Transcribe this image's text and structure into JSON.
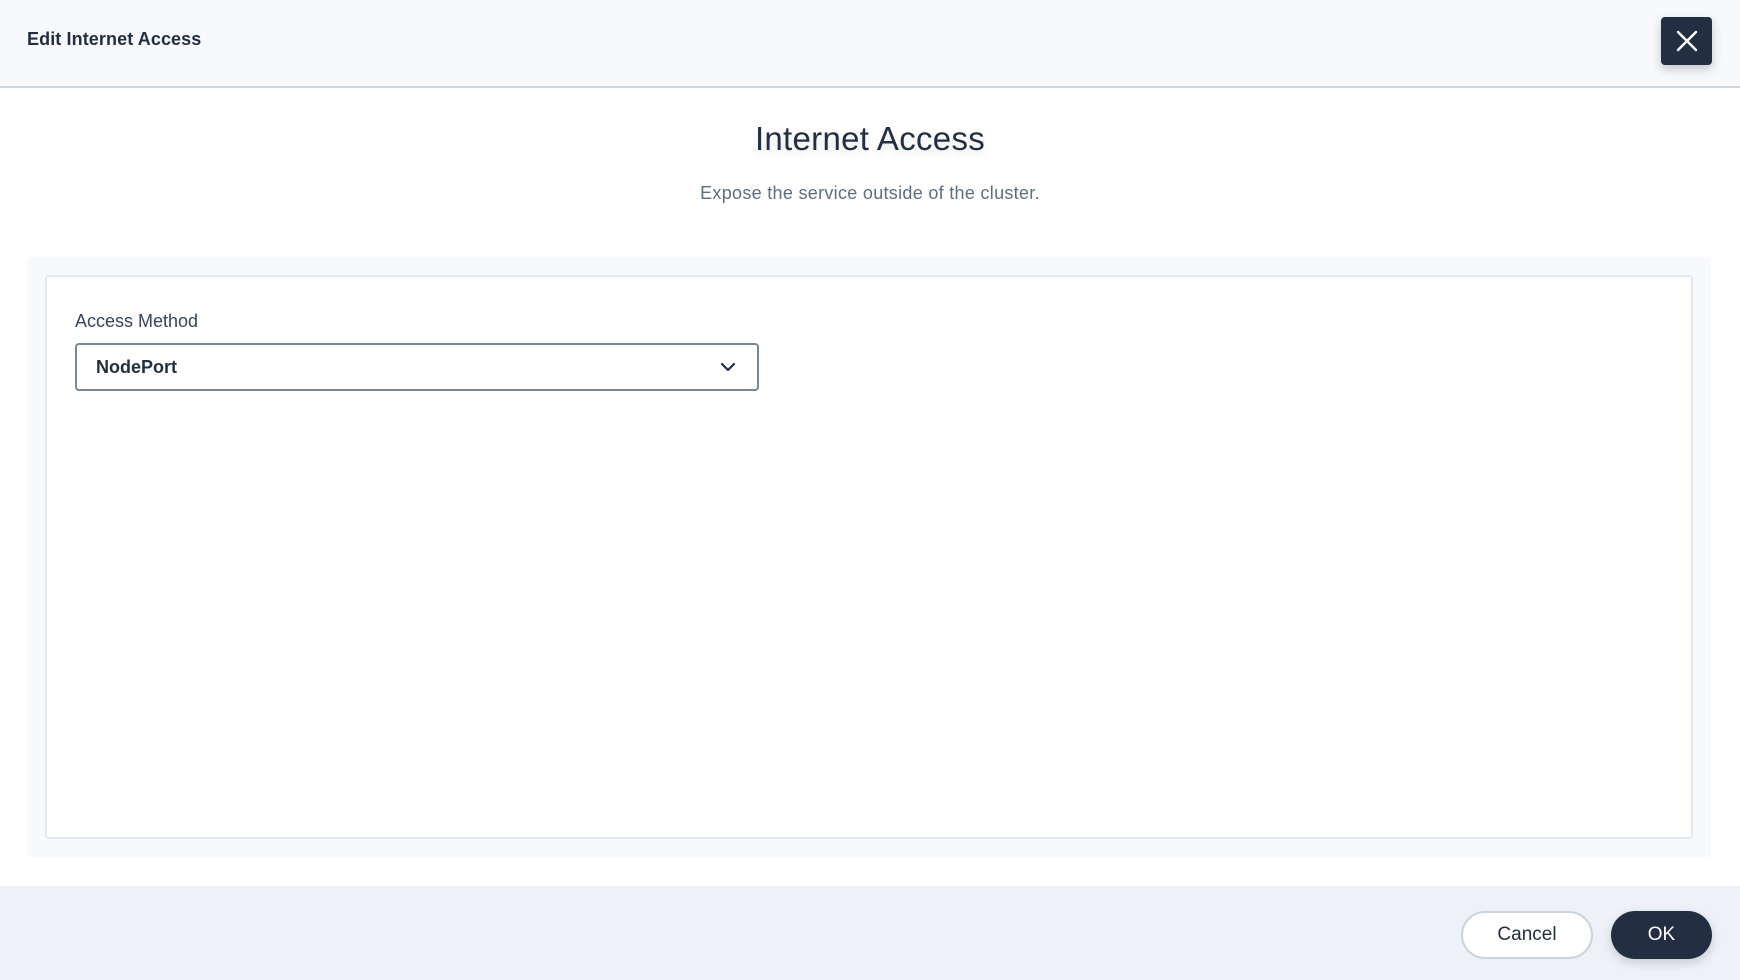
{
  "header": {
    "title": "Edit Internet Access",
    "close_icon": "close-icon"
  },
  "main": {
    "title": "Internet Access",
    "description": "Expose the service outside of the cluster."
  },
  "form": {
    "access_method": {
      "label": "Access Method",
      "value": "NodePort",
      "icon": "chevron-down-icon"
    }
  },
  "footer": {
    "cancel_label": "Cancel",
    "ok_label": "OK"
  },
  "colors": {
    "primary_dark": "#242e42",
    "header_bg": "#f7f9fc",
    "footer_bg": "#eef2f8",
    "text_secondary": "#5f6d82"
  }
}
